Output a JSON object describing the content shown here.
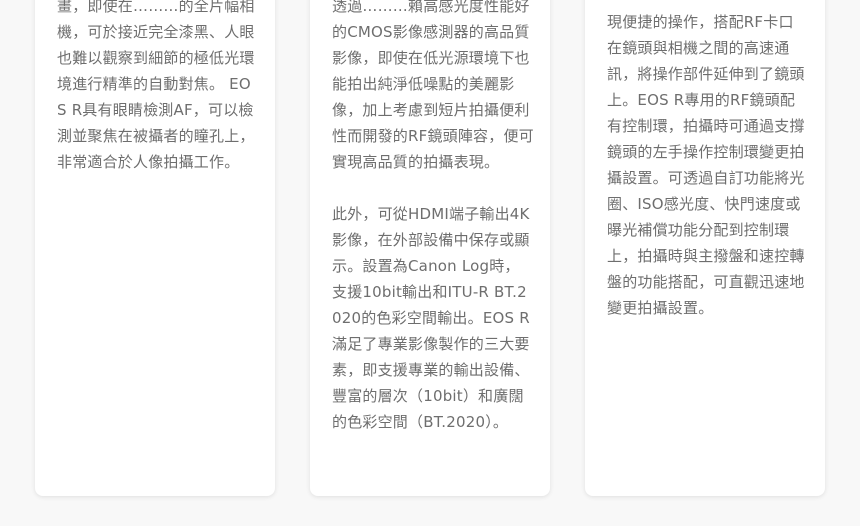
{
  "cards": [
    {
      "paragraphs": [
        "畫，即使在………的全片幅相機，可於接近完全漆黑、人眼也難以觀察到細節的極低光環境進行精準的自動對焦。 EOS R具有眼睛檢測AF，可以檢測並聚焦在被攝者的瞳孔上，非常適合於人像拍攝工作。"
      ]
    },
    {
      "paragraphs": [
        "透過………賴高感光度性能好的CMOS影像感測器的高品質影像，即使在低光源環境下也能拍出純淨低噪點的美麗影像，加上考慮到短片拍攝便利性而開發的RF鏡頭陣容，便可實現高品質的拍攝表現。",
        "此外，可從HDMI端子輸出4K影像，在外部設備中保存或顯示。設置為Canon Log時，支援10bit輸出和ITU-R BT.2020的色彩空間輸出。EOS R滿足了專業影像製作的三大要素，即支援專業的輸出設備、豐富的層次（10bit）和廣闊的色彩空間（BT.2020）。"
      ]
    },
    {
      "paragraphs": [
        "現便捷的操作，搭配RF卡口在鏡頭與相機之間的高速通訊，將操作部件延伸到了鏡頭上。EOS R專用的RF鏡頭配有控制環，拍攝時可通過支撐鏡頭的左手操作控制環變更拍攝設置。可透過自訂功能將光圈、ISO感光度、快門速度或曝光補償功能分配到控制環上，拍攝時與主撥盤和速控轉盤的功能搭配，可直觀迅速地變更拍攝設置。"
      ]
    }
  ]
}
